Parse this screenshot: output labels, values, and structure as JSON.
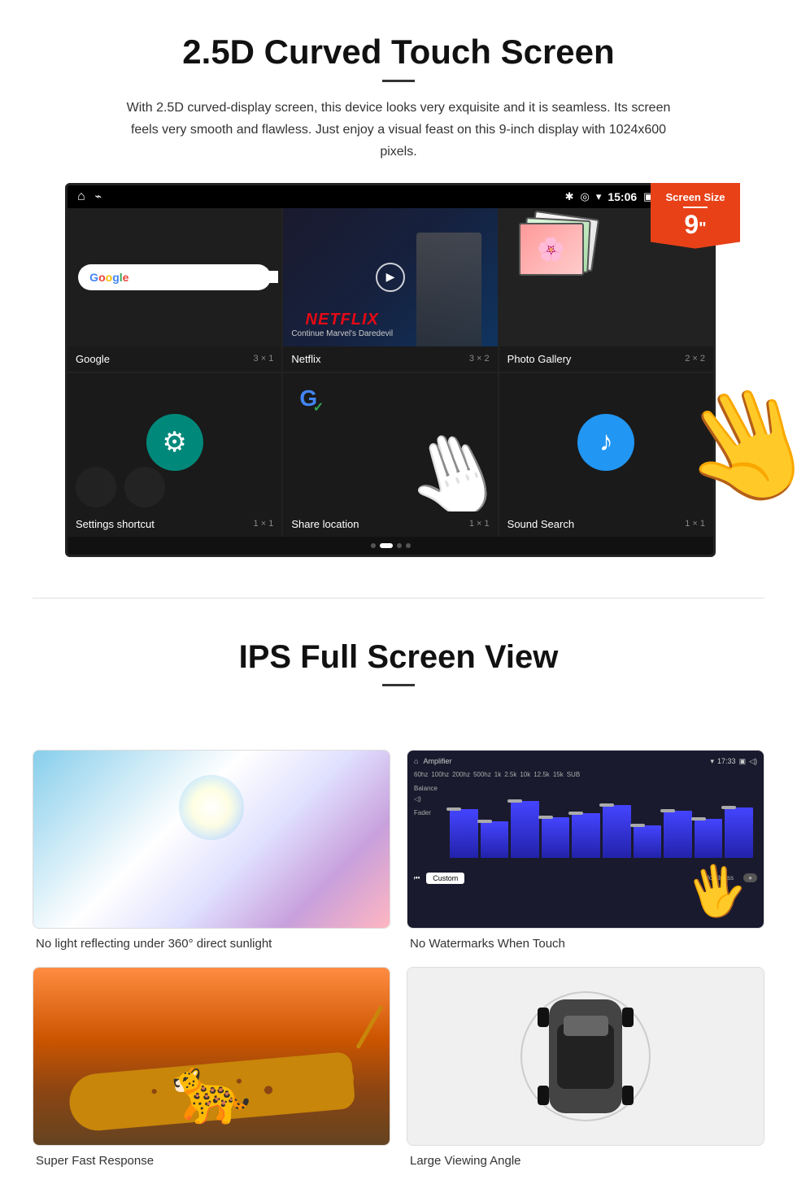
{
  "section1": {
    "title": "2.5D Curved Touch Screen",
    "description": "With 2.5D curved-display screen, this device looks very exquisite and it is seamless. Its screen feels very smooth and flawless. Just enjoy a visual feast on this 9-inch display with 1024x600 pixels.",
    "badge": {
      "label": "Screen Size",
      "size": "9",
      "inch": "\""
    }
  },
  "status_bar": {
    "time": "15:06",
    "icons": [
      "bluetooth",
      "location",
      "wifi",
      "camera",
      "volume",
      "x-box",
      "window"
    ]
  },
  "apps": [
    {
      "name": "Google",
      "size": "3 × 1",
      "type": "google"
    },
    {
      "name": "Netflix",
      "size": "3 × 2",
      "type": "netflix",
      "subtitle": "Continue Marvel's Daredevil"
    },
    {
      "name": "Photo Gallery",
      "size": "2 × 2",
      "type": "gallery"
    },
    {
      "name": "Settings shortcut",
      "size": "1 × 1",
      "type": "settings"
    },
    {
      "name": "Share location",
      "size": "1 × 1",
      "type": "share"
    },
    {
      "name": "Sound Search",
      "size": "1 × 1",
      "type": "sound"
    }
  ],
  "section2": {
    "title": "IPS Full Screen View"
  },
  "features": [
    {
      "caption": "No light reflecting under 360° direct sunlight",
      "type": "sunlight"
    },
    {
      "caption": "No Watermarks When Touch",
      "type": "amplifier"
    },
    {
      "caption": "Super Fast Response",
      "type": "cheetah"
    },
    {
      "caption": "Large Viewing Angle",
      "type": "car"
    }
  ]
}
